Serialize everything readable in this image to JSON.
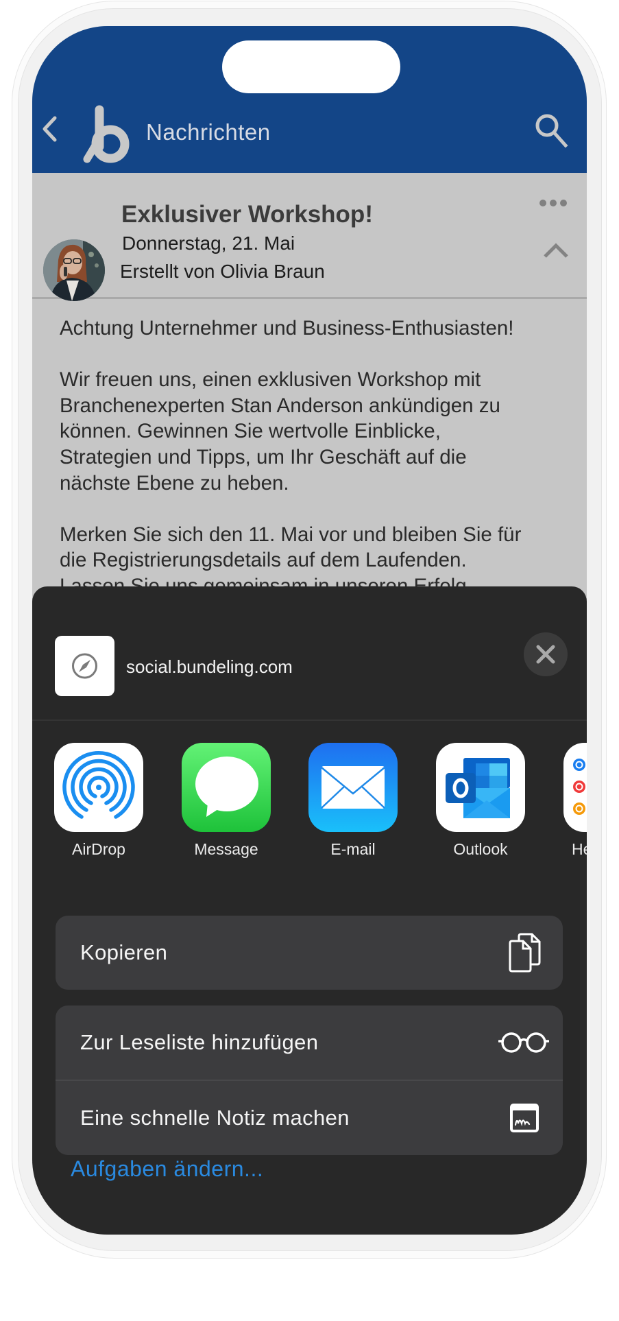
{
  "nav": {
    "title": "Nachrichten",
    "back_icon": "chevron-left-icon",
    "logo": "bundeling-b-logo",
    "search_icon": "search-icon"
  },
  "post": {
    "title": "Exklusiver Workshop!",
    "date": "Donnerstag, 21. Mai",
    "author_line": "Erstellt von Olivia Braun",
    "more_icon": "more-horizontal-icon",
    "collapse_icon": "chevron-up-icon",
    "body": [
      [
        "Achtung Unternehmer und Business-Enthusiasten!"
      ],
      [
        "Wir freuen uns, einen exklusiven Workshop mit",
        "Branchenexperten Stan Anderson ankündigen zu",
        "können. Gewinnen Sie wertvolle Einblicke,",
        "Strategien und Tipps, um Ihr Geschäft auf die",
        "nächste Ebene zu heben."
      ],
      [
        "Merken Sie sich den 11. Mai vor und bleiben Sie für",
        "die Registrierungsdetails auf dem Laufenden.",
        "Lassen Sie uns gemeinsam in unseren Erfolg"
      ]
    ]
  },
  "share_sheet": {
    "url": "social.bundeling.com",
    "thumb_icon": "compass-icon",
    "close_icon": "close-icon",
    "apps": [
      {
        "label": "AirDrop",
        "icon": "airdrop-icon"
      },
      {
        "label": "Message",
        "icon": "messages-icon"
      },
      {
        "label": "E-mail",
        "icon": "mail-icon"
      },
      {
        "label": "Outlook",
        "icon": "outlook-icon"
      },
      {
        "label": "Herinneringen",
        "icon": "reminders-icon"
      }
    ],
    "actions": [
      {
        "label": "Kopieren",
        "icon": "copy-icon"
      },
      {
        "label": "Zur Leseliste hinzufügen",
        "icon": "reading-list-glasses-icon"
      },
      {
        "label": "Eine schnelle Notiz machen",
        "icon": "quick-note-icon"
      }
    ],
    "edit_actions_label": "Aufgaben ändern..."
  },
  "colors": {
    "header_blue": "#134587",
    "link_blue": "#2a8ae0",
    "sheet_bg": "#282828",
    "row_bg": "#3c3c3e",
    "dimmed_content_bg": "#c6c6c6"
  }
}
